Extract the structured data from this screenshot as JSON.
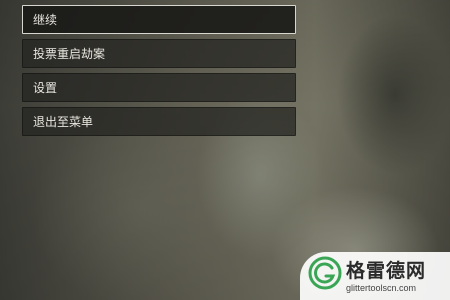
{
  "menu": {
    "items": [
      {
        "label": "继续"
      },
      {
        "label": "投票重启劫案"
      },
      {
        "label": "设置"
      },
      {
        "label": "退出至菜单"
      }
    ],
    "selected_index": 0
  },
  "watermark": {
    "brand": "格雷德网",
    "url": "glittertoolscn.com"
  }
}
